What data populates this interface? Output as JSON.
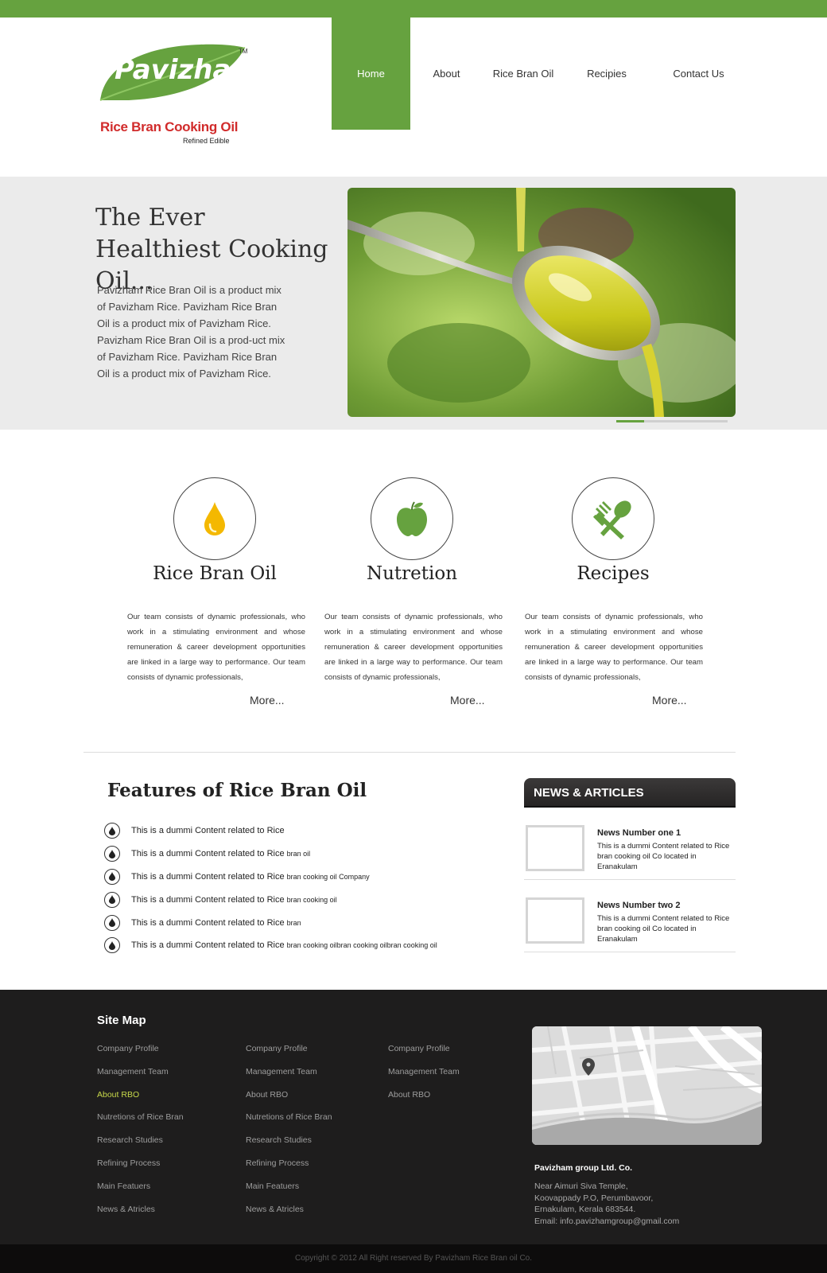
{
  "brand": {
    "name": "Pavizham",
    "tm": "TM",
    "tagline": "Rice Bran Cooking Oil",
    "sub": "Refined Edible"
  },
  "nav": {
    "items": [
      {
        "label": "Home"
      },
      {
        "label": "About"
      },
      {
        "label": "Rice Bran Oil"
      },
      {
        "label": "Recipies"
      },
      {
        "label": "Contact Us"
      }
    ]
  },
  "hero": {
    "title": "The Ever Healthiest Cooking Oil...",
    "text": "Pavizham Rice Bran Oil is a product mix of Pavizham Rice. Pavizham Rice Bran Oil is a product mix of Pavizham Rice. Pavizham Rice Bran Oil is a prod-uct mix of Pavizham Rice. Pavizham Rice Bran Oil is a product mix of Pavizham Rice."
  },
  "services": [
    {
      "title": "Rice Bran Oil",
      "icon": "oil-drop-icon",
      "text": "Our team consists of dynamic professionals, who work in a stimulating environment and whose remuneration & career development opportunities are linked in a large way to performance. Our team consists of dynamic professionals,",
      "more": "More..."
    },
    {
      "title": "Nutretion",
      "icon": "apple-icon",
      "text": "Our team consists of dynamic professionals, who work in a stimulating environment and whose remuneration & career development opportunities are linked in a large way to performance. Our team consists of dynamic professionals,",
      "more": "More..."
    },
    {
      "title": "Recipes",
      "icon": "fork-spoon-icon",
      "text": "Our team consists of dynamic professionals, who work in a stimulating environment and whose remuneration & career development opportunities are linked in a large way to performance. Our team consists of dynamic professionals,",
      "more": "More..."
    }
  ],
  "features": {
    "title": "Features of Rice Bran Oil",
    "items": [
      {
        "text": "This is a dummi Content related to Rice",
        "small": ""
      },
      {
        "text": "This is a dummi Content related to Rice",
        "small": "bran oil"
      },
      {
        "text": "This is a dummi Content related to Rice",
        "small": "bran cooking oil Company"
      },
      {
        "text": "This is a dummi Content related to Rice",
        "small": "bran cooking oil"
      },
      {
        "text": "This is a dummi Content related to Rice",
        "small": "bran"
      },
      {
        "text": "This is a dummi Content related to Rice",
        "small": "bran cooking oilbran cooking oilbran cooking oil"
      }
    ]
  },
  "news": {
    "title": "NEWS & ARTICLES",
    "items": [
      {
        "title": "News Number one 1",
        "text": "This is a dummi Content related to Rice bran cooking oil Co located in Eranakulam"
      },
      {
        "title": "News Number two 2",
        "text": "This is a dummi Content related to Rice bran cooking oil Co located in Eranakulam"
      }
    ]
  },
  "footer": {
    "sitemap_title": "Site Map",
    "col1": [
      "Company Profile",
      "Management Team",
      "About RBO",
      "Nutretions of Rice Bran",
      "Research Studies",
      "Refining Process",
      "Main Featuers",
      "News & Atricles"
    ],
    "col2": [
      "Company Profile",
      "Management Team",
      "About RBO",
      "Nutretions of Rice Bran",
      "Research Studies",
      "Refining Process",
      "Main Featuers",
      "News & Atricles"
    ],
    "col3": [
      "Company Profile",
      "Management Team",
      "About RBO"
    ],
    "active_link_color": "#c7d84a",
    "company": {
      "name": "Pavizham group Ltd. Co.",
      "address": [
        "Near Aimuri Siva Temple,",
        "Koovappady P.O, Perumbavoor,",
        "Ernakulam, Kerala 683544.",
        "Email: info.pavizhamgroup@gmail.com"
      ]
    },
    "copyright": "Copyright © 2012 All Right reserved By Pavizham Rice Bran oil Co."
  },
  "colors": {
    "brand_green": "#66a23f",
    "drop_yellow": "#f4b800",
    "logo_red": "#d12b2b"
  }
}
